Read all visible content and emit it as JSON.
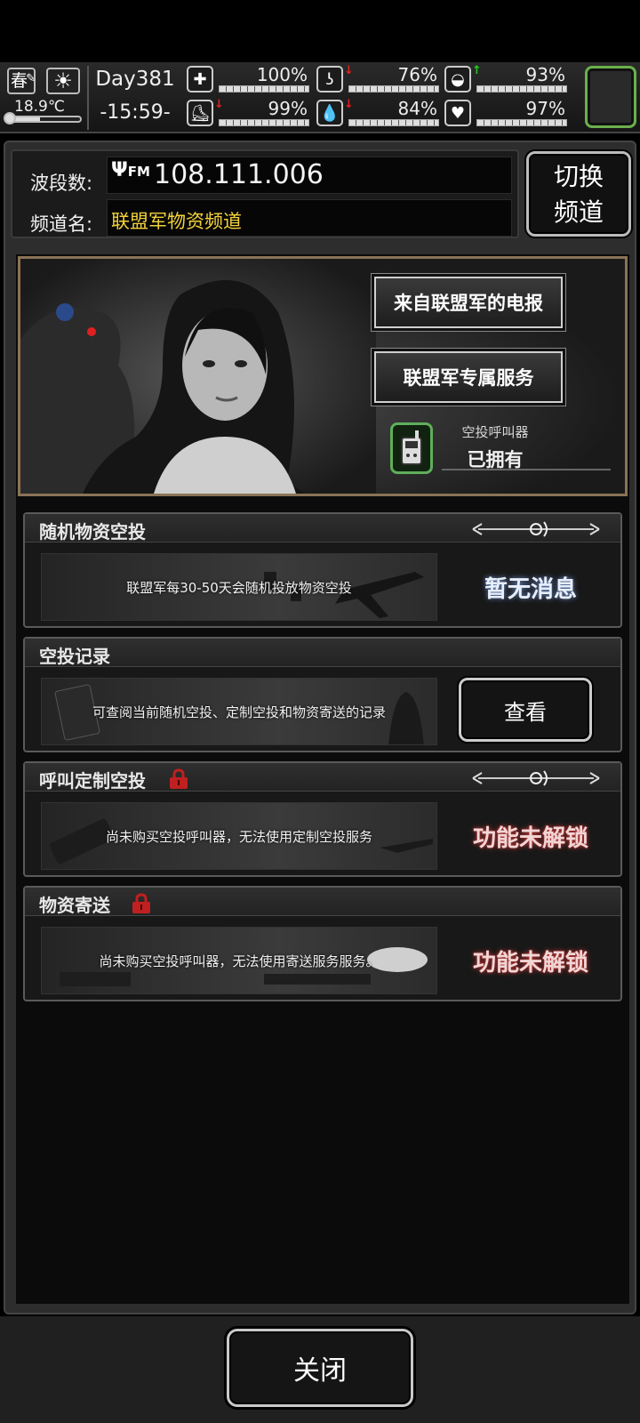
{
  "status": {
    "season": "春",
    "temperature": "18.9℃",
    "day": "Day381",
    "clock": "-15:59-",
    "stats": [
      {
        "name": "health",
        "icon": "medkit-icon",
        "value": "100%",
        "arrow": "",
        "arrow_color": ""
      },
      {
        "name": "stomach",
        "icon": "stomach-icon",
        "value": "76%",
        "arrow": "↓",
        "arrow_color": "#e02020"
      },
      {
        "name": "mood",
        "icon": "mind-icon",
        "value": "93%",
        "arrow": "↑",
        "arrow_color": "#22cc22"
      },
      {
        "name": "stamina",
        "icon": "boot-icon",
        "value": "99%",
        "arrow": "↓",
        "arrow_color": "#e02020"
      },
      {
        "name": "water",
        "icon": "water-drop-icon",
        "value": "84%",
        "arrow": "↓",
        "arrow_color": "#e02020"
      },
      {
        "name": "heart",
        "icon": "heart-icon",
        "value": "97%",
        "arrow": "",
        "arrow_color": ""
      }
    ]
  },
  "radio": {
    "band_label": "波段数:",
    "frequency": "108.111.006",
    "fm_label": "FM",
    "channel_label": "频道名:",
    "channel_name": "联盟军物资频道",
    "switch_label_line1": "切换",
    "switch_label_line2": "频道"
  },
  "banner": {
    "telegram_button": "来自联盟军的电报",
    "service_button": "联盟军专属服务",
    "caller_label": "空投呼叫器",
    "caller_status": "已拥有"
  },
  "sections": {
    "random_drop": {
      "title": "随机物资空投",
      "description": "联盟军每30-50天会随机投放物资空投",
      "status": "暂无消息"
    },
    "drop_record": {
      "title": "空投记录",
      "description": "可查阅当前随机空投、定制空投和物资寄送的记录",
      "button": "查看"
    },
    "custom_drop": {
      "title": "呼叫定制空投",
      "description": "尚未购买空投呼叫器，无法使用定制空投服务",
      "status": "功能未解锁"
    },
    "delivery": {
      "title": "物资寄送",
      "description": "尚未购买空投呼叫器，无法使用寄送服务服务。",
      "status": "功能未解锁"
    }
  },
  "footer": {
    "close_button": "关闭"
  },
  "colors": {
    "channel_name": "#f3d23a",
    "locked_glow": "#c23a3a",
    "avatar_border": "#6ab04c"
  }
}
